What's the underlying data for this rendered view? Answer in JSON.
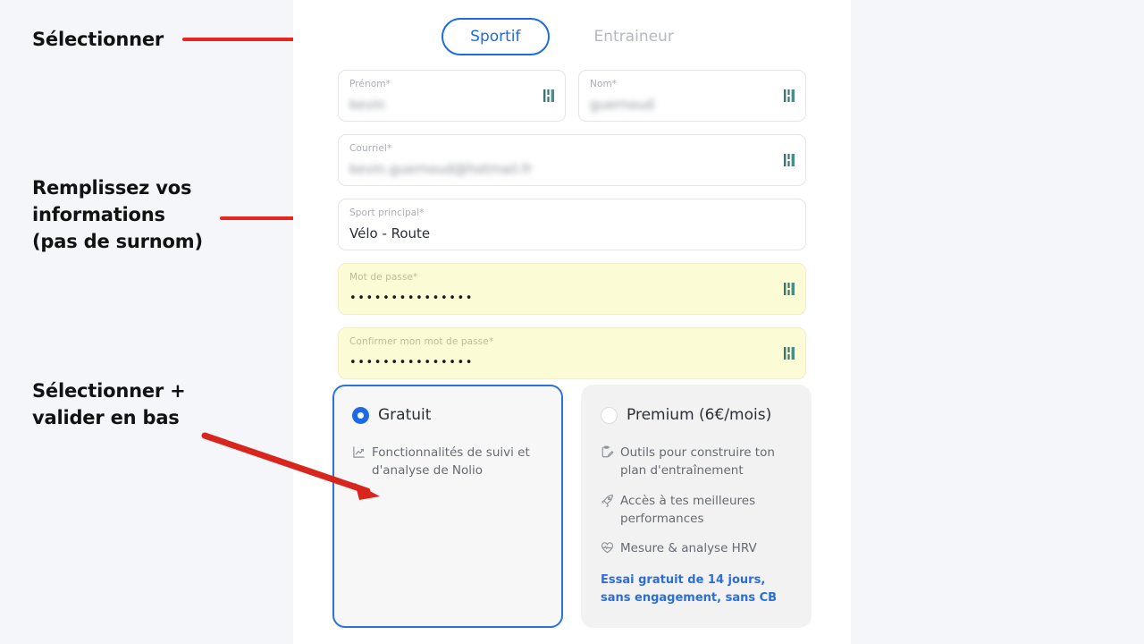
{
  "annotations": {
    "select_tab": "Sélectionner",
    "fill_info": "Remplissez vos\ninformations\n(pas de surnom)",
    "select_validate": "Sélectionner +\nvalider en bas",
    "color": "#e8251e"
  },
  "app": {
    "accent": "#1c6ae4",
    "background": "#ffffff",
    "page_background": "#f5f6fa"
  },
  "role_tabs": [
    {
      "label": "Sportif",
      "active": true
    },
    {
      "label": "Entraineur",
      "active": false
    }
  ],
  "form": {
    "fields": [
      {
        "label": "Prénom*",
        "value": "kevin",
        "redacted": true,
        "autofill": false,
        "icon": "password-key-icon",
        "width": "half"
      },
      {
        "label": "Nom*",
        "value": "guernoud",
        "redacted": true,
        "autofill": false,
        "icon": "password-key-icon",
        "width": "half"
      },
      {
        "label": "Courriel*",
        "value": "kevin.guernoud@hotmail.fr",
        "redacted": true,
        "autofill": false,
        "icon": "password-key-icon",
        "width": "full"
      },
      {
        "label": "Sport principal*",
        "value": "Vélo - Route",
        "redacted": false,
        "autofill": false,
        "icon": null,
        "width": "full"
      },
      {
        "label": "Mot de passe*",
        "value": "•••••••••••••••",
        "redacted": false,
        "autofill": true,
        "icon": "password-key-icon",
        "width": "full"
      },
      {
        "label": "Confirmer mon mot de passe*",
        "value": "•••••••••••••••",
        "redacted": false,
        "autofill": true,
        "icon": "password-key-icon",
        "width": "full"
      }
    ]
  },
  "plans": [
    {
      "title": "Gratuit",
      "selected": true,
      "features": [
        {
          "icon": "chart-line-icon",
          "text": "Fonctionnalités de suivi et d'analyse de Nolio"
        }
      ],
      "trial_note": null
    },
    {
      "title": "Premium (6€/mois)",
      "selected": false,
      "features": [
        {
          "icon": "clipboard-pencil-icon",
          "text": "Outils pour construire ton plan d'entraînement"
        },
        {
          "icon": "rocket-icon",
          "text": "Accès à tes meilleures performances"
        },
        {
          "icon": "heart-pulse-icon",
          "text": "Mesure & analyse HRV"
        }
      ],
      "trial_note": "Essai gratuit de 14 jours, sans engagement, sans CB"
    }
  ]
}
